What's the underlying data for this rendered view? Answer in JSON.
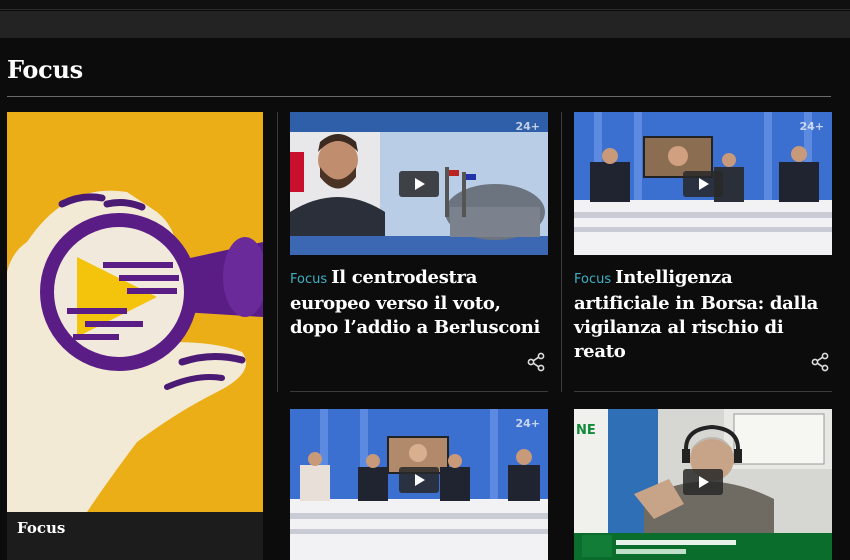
{
  "section": {
    "title": "Focus"
  },
  "feature": {
    "label": "Focus",
    "art_icon": "magnifier-hand-illustration"
  },
  "cards": [
    {
      "kicker": "Focus",
      "title": "Il centrodestra europeo verso il voto, dopo l’addio a Berlusconi",
      "share_icon": "share-icon",
      "badge": "24+"
    },
    {
      "kicker": "Focus",
      "title": "Intelligenza artificiale in Borsa: dalla vigilanza al rischio di reato",
      "share_icon": "share-icon",
      "badge": "24+"
    },
    {
      "badge": "24+"
    },
    {
      "badge": "NE"
    }
  ],
  "colors": {
    "accent_kicker": "#3fb0c4",
    "feature_bg": "#ecae16",
    "page_bg": "#0c0c0c",
    "purple": "#5a1d86"
  }
}
